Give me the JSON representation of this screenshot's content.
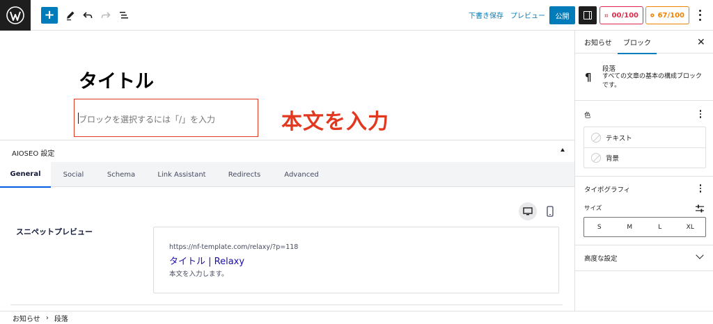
{
  "toolbar": {
    "logo_icon": "wordpress-logo",
    "add_label": "+",
    "save_draft": "下書き保存",
    "preview": "プレビュー",
    "publish": "公開",
    "seo_score_1": "00/100",
    "seo_score_2": "67/100",
    "score_1_color": "#df2a4a",
    "score_2_color": "#f18200"
  },
  "editor": {
    "title": "タイトル",
    "paragraph_placeholder": "ブロックを選択するには「/」を入力",
    "annotation": "本文を入力",
    "annotation_color": "#e2381f"
  },
  "aioseo": {
    "title": "AIOSEO 設定",
    "tabs": [
      "General",
      "Social",
      "Schema",
      "Link Assistant",
      "Redirects",
      "Advanced"
    ],
    "active_tab": "General",
    "snippet_label": "スニペットプレビュー",
    "snippet_url": "https://nf-template.com/relaxy/?p=118",
    "snippet_title": "タイトル | Relaxy",
    "snippet_description": "本文を入力します。"
  },
  "footer": {
    "breadcrumb": [
      "お知らせ",
      "段落"
    ]
  },
  "sidebar": {
    "tabs": [
      "お知らせ",
      "ブロック"
    ],
    "active_tab": "ブロック",
    "block_name": "段落",
    "block_description": "すべての文章の基本の構成ブロックです。",
    "color_section": "色",
    "color_items": [
      "テキスト",
      "背景"
    ],
    "typography_section": "タイポグラフィ",
    "size_label": "サイズ",
    "size_options": [
      "S",
      "M",
      "L",
      "XL"
    ],
    "advanced_section": "高度な設定"
  }
}
